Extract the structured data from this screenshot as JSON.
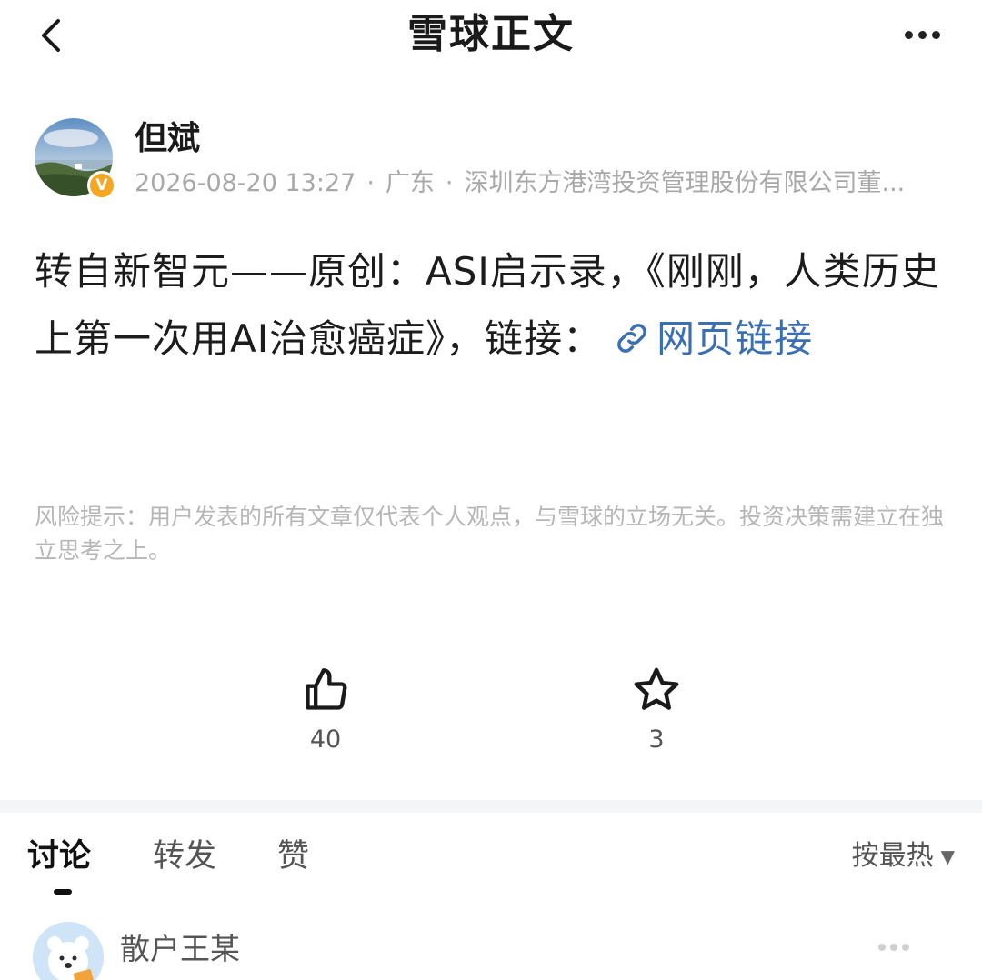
{
  "header": {
    "title": "雪球正文"
  },
  "author": {
    "name": "但斌",
    "verified_badge": "V",
    "datetime": "2026-08-20 13:27",
    "region": "广东",
    "title": "深圳东方港湾投资管理股份有限公司董..."
  },
  "post": {
    "text": "转自新智元——原创：ASI启示录，《刚刚，人类历史上第一次用AI治愈癌症》，链接：",
    "link_label": "网页链接"
  },
  "risk_notice": "风险提示：用户发表的所有文章仅代表个人观点，与雪球的立场无关。投资决策需建立在独立思考之上。",
  "actions": {
    "like_count": "40",
    "favorite_count": "3"
  },
  "tabs": {
    "discuss": "讨论",
    "repost": "转发",
    "like": "赞",
    "sort": "按最热",
    "sort_caret": "▼"
  },
  "comment": {
    "author": "散户王某"
  },
  "colors": {
    "link": "#3b6fb4",
    "verified": "#f5a623",
    "muted_text": "#a8a8a8"
  },
  "icons": [
    "back-arrow-icon",
    "more-icon",
    "link-icon",
    "thumbs-up-icon",
    "star-icon",
    "chevron-down-icon"
  ]
}
